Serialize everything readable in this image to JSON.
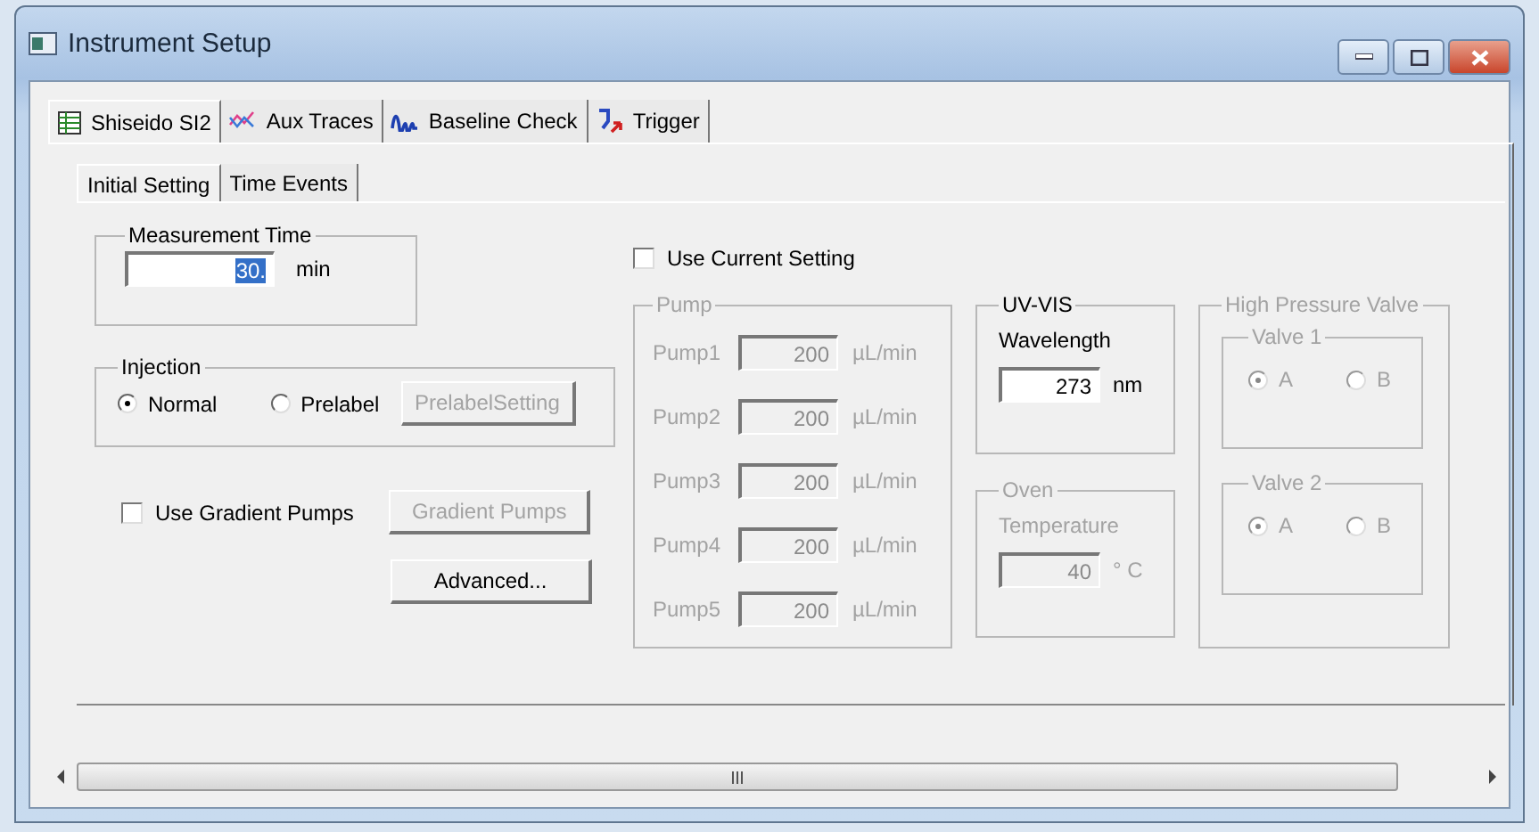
{
  "window": {
    "title": "Instrument Setup"
  },
  "tabs": [
    {
      "label": "Shiseido SI2",
      "selected": true,
      "kind": "table"
    },
    {
      "label": "Aux Traces",
      "selected": false,
      "kind": "traces"
    },
    {
      "label": "Baseline Check",
      "selected": false,
      "kind": "wave"
    },
    {
      "label": "Trigger",
      "selected": false,
      "kind": "trigger"
    }
  ],
  "subtabs": [
    {
      "label": "Initial Setting",
      "selected": true
    },
    {
      "label": "Time Events",
      "selected": false
    }
  ],
  "measurement_time": {
    "title": "Measurement Time",
    "value": "30.",
    "unit": "min"
  },
  "injection": {
    "title": "Injection",
    "options": [
      {
        "label": "Normal",
        "selected": true
      },
      {
        "label": "Prelabel",
        "selected": false
      }
    ],
    "button": {
      "label": "PrelabelSetting",
      "disabled": true
    }
  },
  "gradient": {
    "label": "Use Gradient Pumps",
    "checked": false,
    "button": {
      "label": "Gradient Pumps",
      "disabled": true
    }
  },
  "advanced_button": {
    "label": "Advanced...",
    "disabled": false
  },
  "use_current_setting": {
    "label": "Use Current Setting",
    "checked": false
  },
  "pump": {
    "title": "Pump",
    "disabled": true,
    "rows": [
      {
        "label": "Pump1",
        "value": "200",
        "unit": "µL/min"
      },
      {
        "label": "Pump2",
        "value": "200",
        "unit": "µL/min"
      },
      {
        "label": "Pump3",
        "value": "200",
        "unit": "µL/min"
      },
      {
        "label": "Pump4",
        "value": "200",
        "unit": "µL/min"
      },
      {
        "label": "Pump5",
        "value": "200",
        "unit": "µL/min"
      }
    ]
  },
  "uv_vis": {
    "title": "UV-VIS",
    "disabled": false,
    "label": "Wavelength",
    "value": "273",
    "unit": "nm"
  },
  "oven": {
    "title": "Oven",
    "disabled": true,
    "label": "Temperature",
    "value": "40",
    "unit": "° C"
  },
  "high_pressure_valve": {
    "title": "High Pressure Valve",
    "disabled": true,
    "valves": [
      {
        "title": "Valve 1",
        "options": [
          {
            "label": "A",
            "selected": true
          },
          {
            "label": "B",
            "selected": false
          }
        ]
      },
      {
        "title": "Valve 2",
        "options": [
          {
            "label": "A",
            "selected": true
          },
          {
            "label": "B",
            "selected": false
          }
        ]
      }
    ]
  }
}
